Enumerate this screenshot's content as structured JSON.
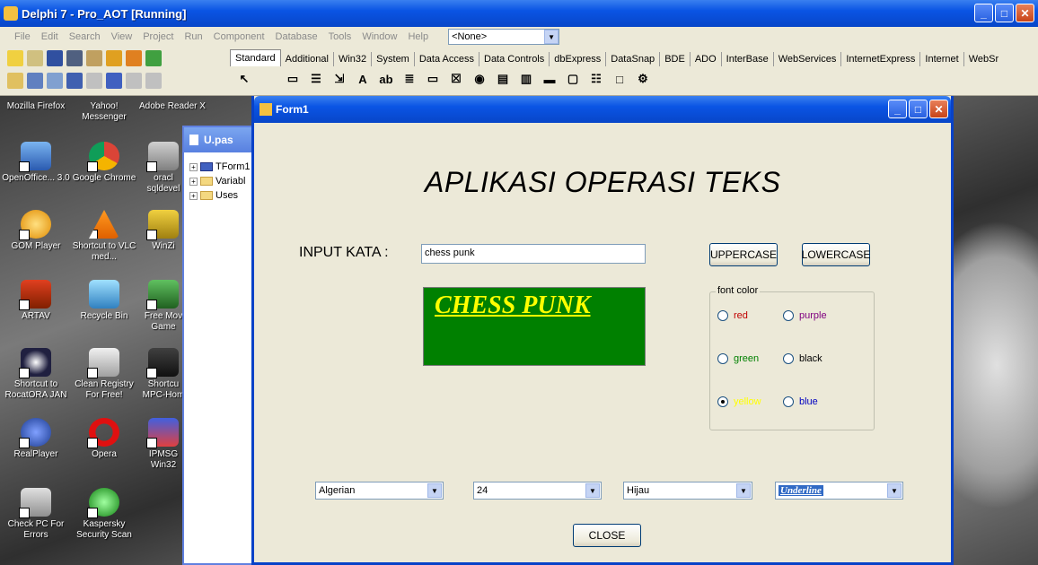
{
  "app": {
    "title": "Delphi 7 - Pro_AOT [Running]"
  },
  "menu": {
    "items": [
      "File",
      "Edit",
      "Search",
      "View",
      "Project",
      "Run",
      "Component",
      "Database",
      "Tools",
      "Window",
      "Help"
    ],
    "combo_value": "<None>"
  },
  "palette": {
    "tabs": [
      "Standard",
      "Additional",
      "Win32",
      "System",
      "Data Access",
      "Data Controls",
      "dbExpress",
      "DataSnap",
      "BDE",
      "ADO",
      "InterBase",
      "WebServices",
      "InternetExpress",
      "Internet",
      "WebSr"
    ]
  },
  "desktop": {
    "icons": [
      {
        "label": "Mozilla Firefox"
      },
      {
        "label": "Yahoo! Messenger"
      },
      {
        "label": "Adobe Reader X"
      },
      {
        "label": "OpenOffice... 3.0"
      },
      {
        "label": "Google Chrome"
      },
      {
        "label": "oracl sqldevel"
      },
      {
        "label": "GOM Player"
      },
      {
        "label": "Shortcut to VLC med..."
      },
      {
        "label": "WinZi"
      },
      {
        "label": "ARTAV"
      },
      {
        "label": "Recycle Bin"
      },
      {
        "label": "Free Mov Game"
      },
      {
        "label": "Shortcut to RocatORA JAN"
      },
      {
        "label": "Clean Registry For Free!"
      },
      {
        "label": "Shortcu MPC-Hom"
      },
      {
        "label": "RealPlayer"
      },
      {
        "label": "Opera"
      },
      {
        "label": "IPMSG Win32"
      },
      {
        "label": "Check PC For Errors"
      },
      {
        "label": "Kaspersky Security Scan"
      }
    ]
  },
  "unit_window": {
    "title": "U.pas",
    "tree": [
      "TForm1",
      "Variabl",
      "Uses"
    ]
  },
  "form": {
    "title": "Form1",
    "heading": "APLIKASI OPERASI TEKS",
    "input_label": "INPUT KATA :",
    "input_value": "chess punk",
    "uppercase_label": "UPPERCASE",
    "lowercase_label": "LOWERCASE",
    "preview_text": "CHESS PUNK",
    "font_color_group": {
      "legend": "font color",
      "options": [
        {
          "label": "red",
          "color": "#c00000",
          "checked": false
        },
        {
          "label": "purple",
          "color": "#800080",
          "checked": false
        },
        {
          "label": "green",
          "color": "#008000",
          "checked": false
        },
        {
          "label": "black",
          "color": "#000000",
          "checked": false
        },
        {
          "label": "yellow",
          "color": "#ffff00",
          "checked": true
        },
        {
          "label": "blue",
          "color": "#0000c0",
          "checked": false
        }
      ]
    },
    "font_select": "Algerian",
    "size_select": "24",
    "bg_color_select": "Hijau",
    "style_select": "Underline",
    "close_label": "CLOSE"
  }
}
